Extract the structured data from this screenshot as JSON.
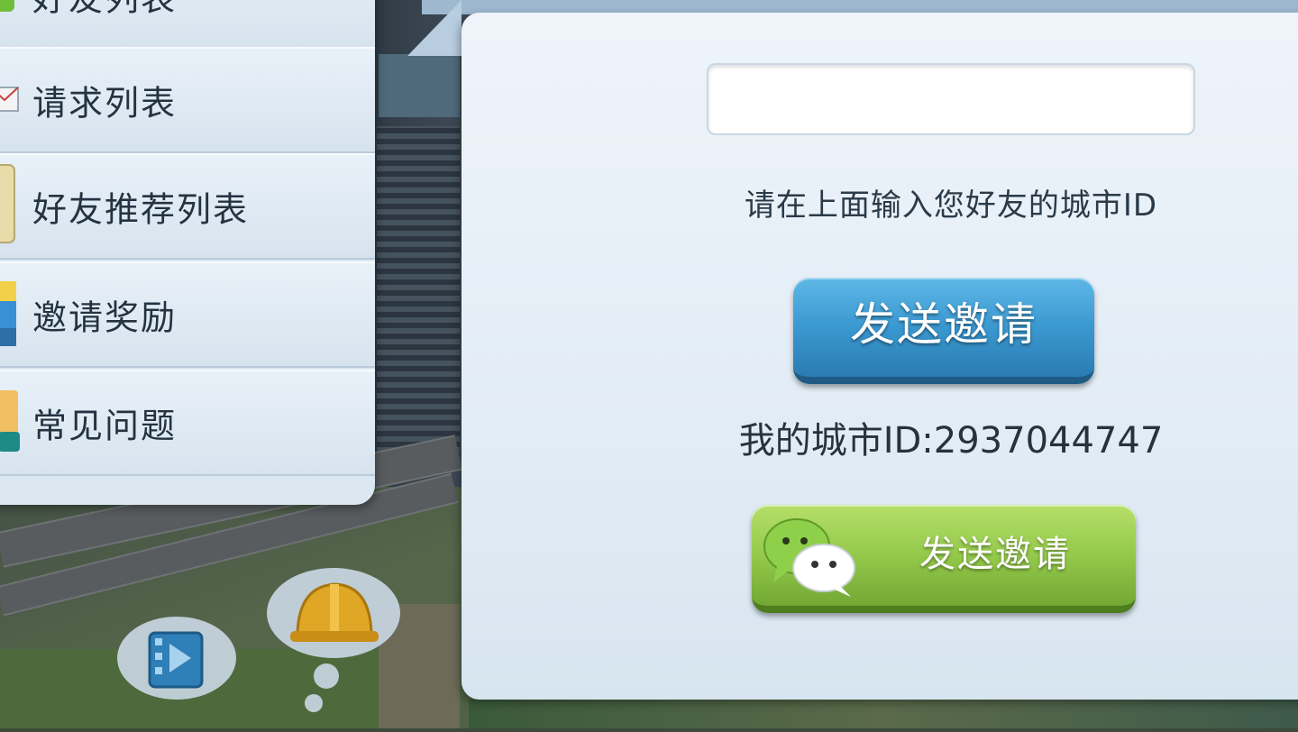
{
  "menu": {
    "items": [
      {
        "label": "好友列表",
        "icon": "friends-icon"
      },
      {
        "label": "请求列表",
        "icon": "mail-icon"
      },
      {
        "label": "好友推荐列表",
        "icon": "recommend-icon"
      },
      {
        "label": "邀请奖励",
        "icon": "reward-icon"
      },
      {
        "label": "常见问题",
        "icon": "faq-icon"
      }
    ]
  },
  "invite": {
    "input_value": "",
    "hint": "请在上面输入您好友的城市ID",
    "send_label": "发送邀请",
    "my_id": "我的城市ID:2937044747",
    "wechat_label": "发送邀请"
  },
  "hud": {
    "buttons": [
      {
        "icon": "video-film-icon"
      },
      {
        "icon": "hardhat-icon"
      }
    ]
  },
  "colors": {
    "panel": "#e2ecf5",
    "send_button": "#3a98d0",
    "wechat_button": "#94c94b",
    "text": "#233341"
  }
}
